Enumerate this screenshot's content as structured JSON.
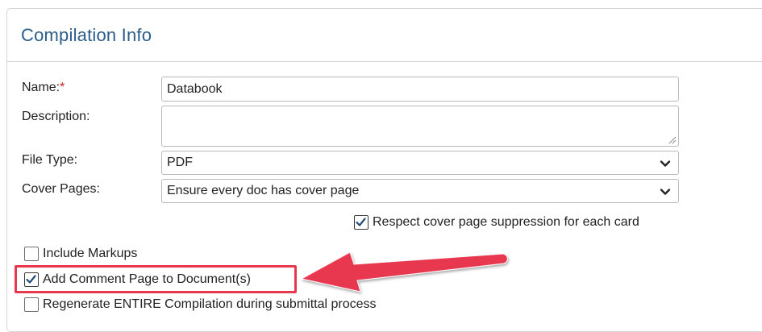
{
  "panel": {
    "title": "Compilation Info"
  },
  "form": {
    "name": {
      "label": "Name:",
      "required_mark": "*",
      "value": "Databook"
    },
    "description": {
      "label": "Description:",
      "value": ""
    },
    "file_type": {
      "label": "File Type:",
      "selected": "PDF"
    },
    "cover_pages": {
      "label": "Cover Pages:",
      "selected": "Ensure every doc has cover page"
    }
  },
  "options": {
    "respect_cover_suppression": {
      "label": "Respect cover page suppression for each card",
      "checked": true
    },
    "include_markups": {
      "label": "Include Markups",
      "checked": false
    },
    "add_comment_page": {
      "label": "Add Comment Page to Document(s)",
      "checked": true
    },
    "regenerate_entire": {
      "label": "Regenerate ENTIRE Compilation during submittal process",
      "checked": false
    }
  },
  "annotation": {
    "highlight_color": "#e8384f",
    "arrow_color": "#e8384f"
  },
  "icons": {
    "dropdown": "chevron-down-icon",
    "resize": "resize-grip-icon",
    "check": "check-icon",
    "pointer": "arrow-left-icon"
  },
  "colors": {
    "title": "#2b5d8a",
    "required": "#cc2222",
    "border": "#b9b9b9"
  }
}
